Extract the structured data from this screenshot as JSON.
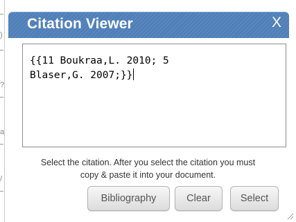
{
  "dialog": {
    "title": "Citation Viewer",
    "close_label": "X"
  },
  "citation_text": "{{11 Boukraa,L. 2010; 5\nBlaser,G. 2007;}}",
  "instructions": {
    "line1": "Select the citation. After you select the citation you must",
    "line2": "copy & paste it into your document."
  },
  "buttons": {
    "bibliography": "Bibliography",
    "clear": "Clear",
    "select": "Select"
  },
  "colors": {
    "titlebar": "#4f7fb8",
    "title_text": "#ffffff"
  },
  "icons": {
    "close": "close-icon",
    "resize": "resize-grip-icon"
  }
}
